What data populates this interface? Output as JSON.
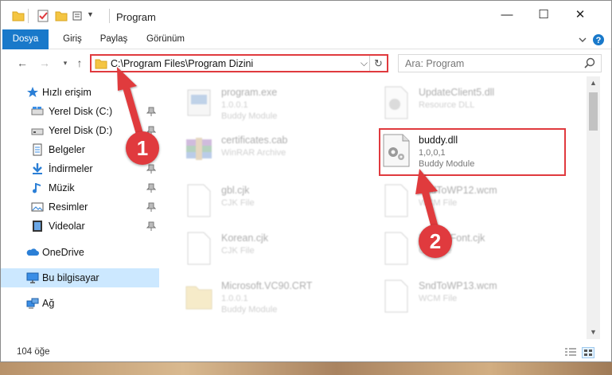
{
  "window": {
    "title": "Program",
    "controls": {
      "minimize": "—",
      "maximize": "☐",
      "close": "✕"
    }
  },
  "ribbon": {
    "tabs": [
      "Dosya",
      "Giriş",
      "Paylaş",
      "Görünüm"
    ],
    "help_icon": "help-icon"
  },
  "navigation": {
    "address_path": "C:\\Program Files\\Program Dizini",
    "search_placeholder": "Ara: Program"
  },
  "sidebar": {
    "items": [
      {
        "label": "Hızlı erişim",
        "icon": "star-icon"
      },
      {
        "label": "Yerel Disk (C:)",
        "icon": "drive-icon",
        "pinned": true
      },
      {
        "label": "Yerel Disk (D:)",
        "icon": "drive-icon",
        "pinned": true
      },
      {
        "label": "Belgeler",
        "icon": "documents-icon",
        "pinned": true
      },
      {
        "label": "İndirmeler",
        "icon": "downloads-icon",
        "pinned": true
      },
      {
        "label": "Müzik",
        "icon": "music-icon",
        "pinned": true
      },
      {
        "label": "Resimler",
        "icon": "pictures-icon",
        "pinned": true
      },
      {
        "label": "Videolar",
        "icon": "videos-icon",
        "pinned": true
      },
      {
        "label": "OneDrive",
        "icon": "cloud-icon"
      },
      {
        "label": "Bu bilgisayar",
        "icon": "computer-icon",
        "selected": true
      },
      {
        "label": "Ağ",
        "icon": "network-icon"
      }
    ]
  },
  "files": [
    {
      "name": "program.exe",
      "sub1": "1.0.0.1",
      "sub2": "Buddy Module",
      "faded": true,
      "icon": "exe-icon"
    },
    {
      "name": "UpdateClient5.dll",
      "sub1": "Resource DLL",
      "sub2": "",
      "faded": true,
      "icon": "dll-icon"
    },
    {
      "name": "certificates.cab",
      "sub1": "WinRAR Archive",
      "sub2": "",
      "faded": true,
      "icon": "archive-icon"
    },
    {
      "name": "buddy.dll",
      "sub1": "1,0,0,1",
      "sub2": "Buddy Module",
      "faded": false,
      "icon": "dll-icon"
    },
    {
      "name": "gbl.cjk",
      "sub1": "CJK File",
      "sub2": "",
      "faded": true,
      "icon": "file-icon"
    },
    {
      "name": "SndToWP12.wcm",
      "sub1": "WCM File",
      "sub2": "",
      "faded": true,
      "icon": "file-icon"
    },
    {
      "name": "Korean.cjk",
      "sub1": "CJK File",
      "sub2": "",
      "faded": true,
      "icon": "file-icon"
    },
    {
      "name": "DefaultFont.cjk",
      "sub1": "CJK File",
      "sub2": "",
      "faded": true,
      "icon": "file-icon"
    },
    {
      "name": "Microsoft.VC90.CRT",
      "sub1": "1.0.0.1",
      "sub2": "Buddy Module",
      "faded": true,
      "icon": "folder-icon"
    },
    {
      "name": "SndToWP13.wcm",
      "sub1": "WCM File",
      "sub2": "",
      "faded": true,
      "icon": "file-icon"
    }
  ],
  "status": {
    "count": "104 öğe"
  },
  "annotations": {
    "badge1": "1",
    "badge2": "2",
    "color": "#e03a3e"
  }
}
